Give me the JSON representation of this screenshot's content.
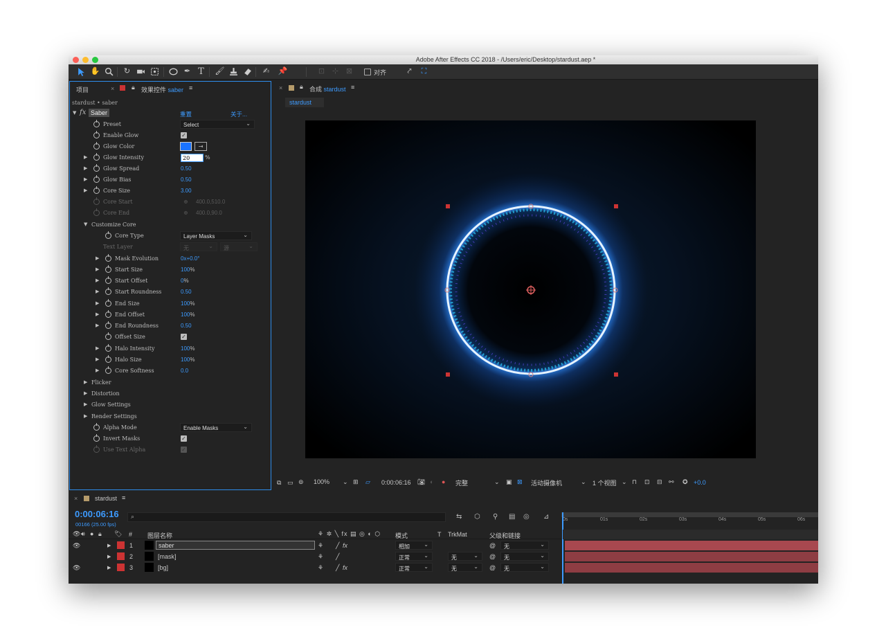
{
  "window": {
    "title": "Adobe After Effects CC 2018 - /Users/eric/Desktop/stardust.aep *"
  },
  "toolbar": {
    "snap_label": "对齐"
  },
  "effects_panel": {
    "tab_project": "项目",
    "tab_effects_prefix": "效果控件",
    "tab_effects_layer": "saber",
    "breadcrumb": "stardust • saber",
    "effect_name": "Saber",
    "reset_label": "重置",
    "about_label": "关于...",
    "props": [
      {
        "label": "Preset",
        "value": "Select"
      },
      {
        "label": "Enable Glow",
        "value": "checked"
      },
      {
        "label": "Glow Color",
        "value": ""
      },
      {
        "label": "Glow Intensity",
        "value": "20",
        "unit": "%"
      },
      {
        "label": "Glow Spread",
        "value": "0.50"
      },
      {
        "label": "Glow Bias",
        "value": "0.50"
      },
      {
        "label": "Core Size",
        "value": "3.00"
      },
      {
        "label": "Core Start",
        "value": "400.0,510.0"
      },
      {
        "label": "Core End",
        "value": "400.0,90.0"
      },
      {
        "label": "Customize Core",
        "value": ""
      },
      {
        "label": "Core Type",
        "value": "Layer Masks"
      },
      {
        "label": "Text Layer",
        "value": "无",
        "value2": "源"
      },
      {
        "label": "Mask Evolution",
        "value": "0x+0.0°"
      },
      {
        "label": "Start Size",
        "value": "100",
        "unit": "%"
      },
      {
        "label": "Start Offset",
        "value": "0",
        "unit": "%"
      },
      {
        "label": "Start Roundness",
        "value": "0.50"
      },
      {
        "label": "End Size",
        "value": "100",
        "unit": "%"
      },
      {
        "label": "End Offset",
        "value": "100",
        "unit": "%"
      },
      {
        "label": "End Roundness",
        "value": "0.50"
      },
      {
        "label": "Offset Size",
        "value": "checked"
      },
      {
        "label": "Halo Intensity",
        "value": "100",
        "unit": "%"
      },
      {
        "label": "Halo Size",
        "value": "100",
        "unit": "%"
      },
      {
        "label": "Core Softness",
        "value": "0.0"
      },
      {
        "label": "Flicker"
      },
      {
        "label": "Distortion"
      },
      {
        "label": "Glow Settings"
      },
      {
        "label": "Render Settings"
      },
      {
        "label": "Alpha Mode",
        "value": "Enable Masks"
      },
      {
        "label": "Invert Masks",
        "value": "checked"
      },
      {
        "label": "Use Text Alpha",
        "value": "checked"
      }
    ]
  },
  "comp_panel": {
    "tab_prefix": "合成",
    "tab_name": "stardust",
    "subtab": "stardust",
    "zoom": "100%",
    "timecode": "0:00:06:16",
    "resolution": "完整",
    "camera": "活动摄像机",
    "views": "1 个视图",
    "exposure": "+0.0"
  },
  "timeline": {
    "tab": "stardust",
    "timecode": "0:00:06:16",
    "frame_info": "00166 (25.00 fps)",
    "col_layer_name": "图层名称",
    "col_num": "#",
    "col_mode": "模式",
    "col_t": "T",
    "col_trkmat": "TrkMat",
    "col_parent": "父级和链接",
    "ruler": [
      "0s",
      "01s",
      "02s",
      "03s",
      "04s",
      "05s",
      "06s"
    ],
    "layers": [
      {
        "num": "1",
        "name": "saber",
        "mode": "相加",
        "trkmat": "",
        "parent": "无"
      },
      {
        "num": "2",
        "name": "[mask]",
        "mode": "正常",
        "trkmat": "无",
        "parent": "无"
      },
      {
        "num": "3",
        "name": "[bg]",
        "mode": "正常",
        "trkmat": "无",
        "parent": "无"
      }
    ]
  },
  "colors": {
    "accent": "#3d9bff",
    "glow": "#1a73ff",
    "layer_bar": "#a8484f",
    "label_red": "#cc3333"
  }
}
